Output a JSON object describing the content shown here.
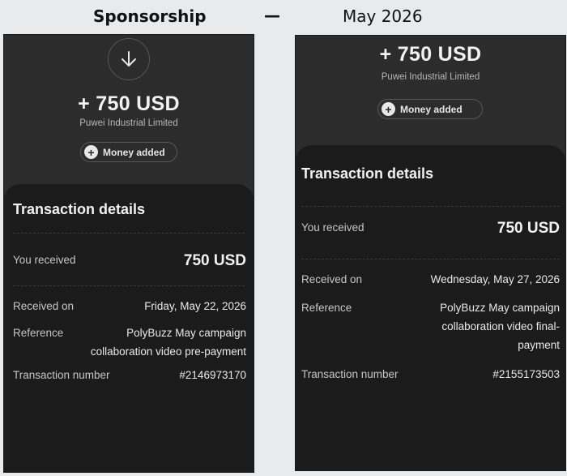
{
  "header": {
    "title": "Sponsorship",
    "dash": "—",
    "date": "May 2026"
  },
  "receipts": [
    {
      "amount": "+ 750 USD",
      "company": "Puwei Industrial Limited",
      "status_label": "Money added",
      "card_title": "Transaction details",
      "rows": {
        "received_label": "You received",
        "received_value": "750 USD",
        "date_label": "Received on",
        "date_value": "Friday, May 22, 2026",
        "reference_label": "Reference",
        "reference_value": "PolyBuzz May campaign collaboration video pre-payment",
        "txn_label": "Transaction number",
        "txn_value": "#2146973170"
      }
    },
    {
      "amount": "+ 750 USD",
      "company": "Puwei Industrial Limited",
      "status_label": "Money added",
      "card_title": "Transaction details",
      "rows": {
        "received_label": "You received",
        "received_value": "750 USD",
        "date_label": "Received on",
        "date_value": "Wednesday, May 27, 2026",
        "reference_label": "Reference",
        "reference_value": "PolyBuzz May campaign collaboration video final-payment",
        "txn_label": "Transaction number",
        "txn_value": "#2155173503"
      }
    }
  ],
  "icons": {
    "arrow": "arrow-down-icon",
    "plus": "plus-icon"
  },
  "colors": {
    "page_bg": "#e9eaec",
    "phone_bg": "#2c2c2c",
    "card_bg": "#1b1b1b",
    "text_primary": "#f2f2f2",
    "text_secondary": "#b7b7b7"
  }
}
